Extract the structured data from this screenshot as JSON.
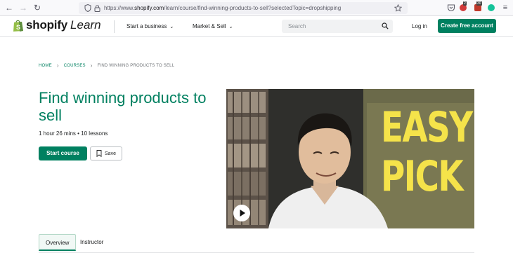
{
  "browser": {
    "url_prefix": "https://www.",
    "url_host": "shopify.com",
    "url_rest": "/learn/course/find-winning-products-to-sell?selectedTopic=dropshipping",
    "extension_badges": [
      "2",
      "30"
    ]
  },
  "header": {
    "logo_text": "shopify",
    "logo_suffix": "Learn",
    "menu": [
      {
        "label": "Start a business"
      },
      {
        "label": "Market & Sell"
      }
    ],
    "search_placeholder": "Search",
    "login_label": "Log in",
    "cta_label": "Create free account",
    "brand_color": "#008060"
  },
  "breadcrumb": {
    "home": "HOME",
    "courses": "COURSES",
    "current": "FIND WINNING PRODUCTS TO SELL"
  },
  "course": {
    "title": "Find winning products to sell",
    "meta": "1 hour 26 mins • 10 lessons",
    "start_label": "Start course",
    "save_label": "Save",
    "image_text": [
      "EASY",
      "PICK"
    ],
    "image_text_color": "#f5e34a"
  },
  "tabs": [
    {
      "label": "Overview",
      "active": true
    },
    {
      "label": "Instructor",
      "active": false
    }
  ]
}
